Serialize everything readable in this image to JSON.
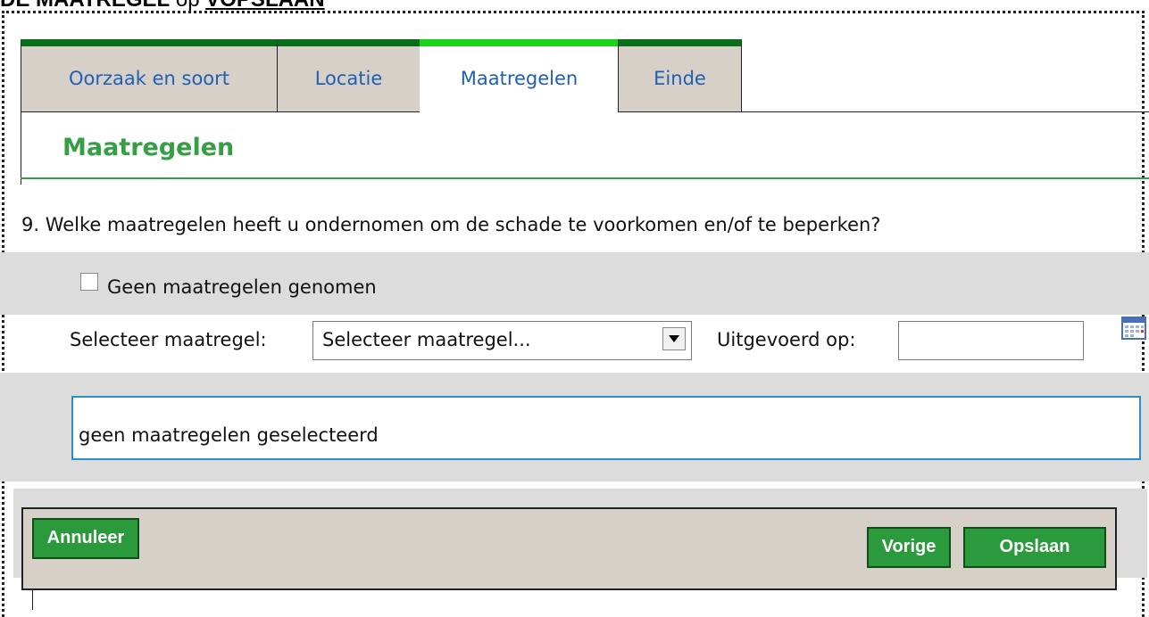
{
  "caption": {
    "prefix": "DE MAATREGEL",
    "mid": " op ",
    "link": "VOPSLAAN"
  },
  "tabs": [
    {
      "label": "Oorzaak en soort",
      "active": false
    },
    {
      "label": "Locatie",
      "active": false
    },
    {
      "label": "Maatregelen",
      "active": true
    },
    {
      "label": "Einde",
      "active": false
    }
  ],
  "section": {
    "title": "Maatregelen"
  },
  "question": {
    "text": "9.  Welke maatregelen heeft u ondernomen om de schade te voorkomen en/of te beperken?"
  },
  "checkbox": {
    "label": "Geen maatregelen genomen",
    "checked": false
  },
  "select": {
    "label": "Selecteer maatregel:",
    "value": "Selecteer maatregel..."
  },
  "date": {
    "label": "Uitgevoerd op:",
    "value": ""
  },
  "result": {
    "text": "geen maatregelen geselecteerd"
  },
  "buttons": {
    "cancel": "Annuleer",
    "previous": "Vorige",
    "save": "Opslaan"
  },
  "colors": {
    "accent_green": "#34a043",
    "active_tab_bar": "#19d419",
    "tab_bar": "#0b6e1b",
    "link_blue": "#1f5fb4"
  },
  "icons": {
    "calendar": "calendar-icon",
    "dropdown": "chevron-down-icon"
  }
}
